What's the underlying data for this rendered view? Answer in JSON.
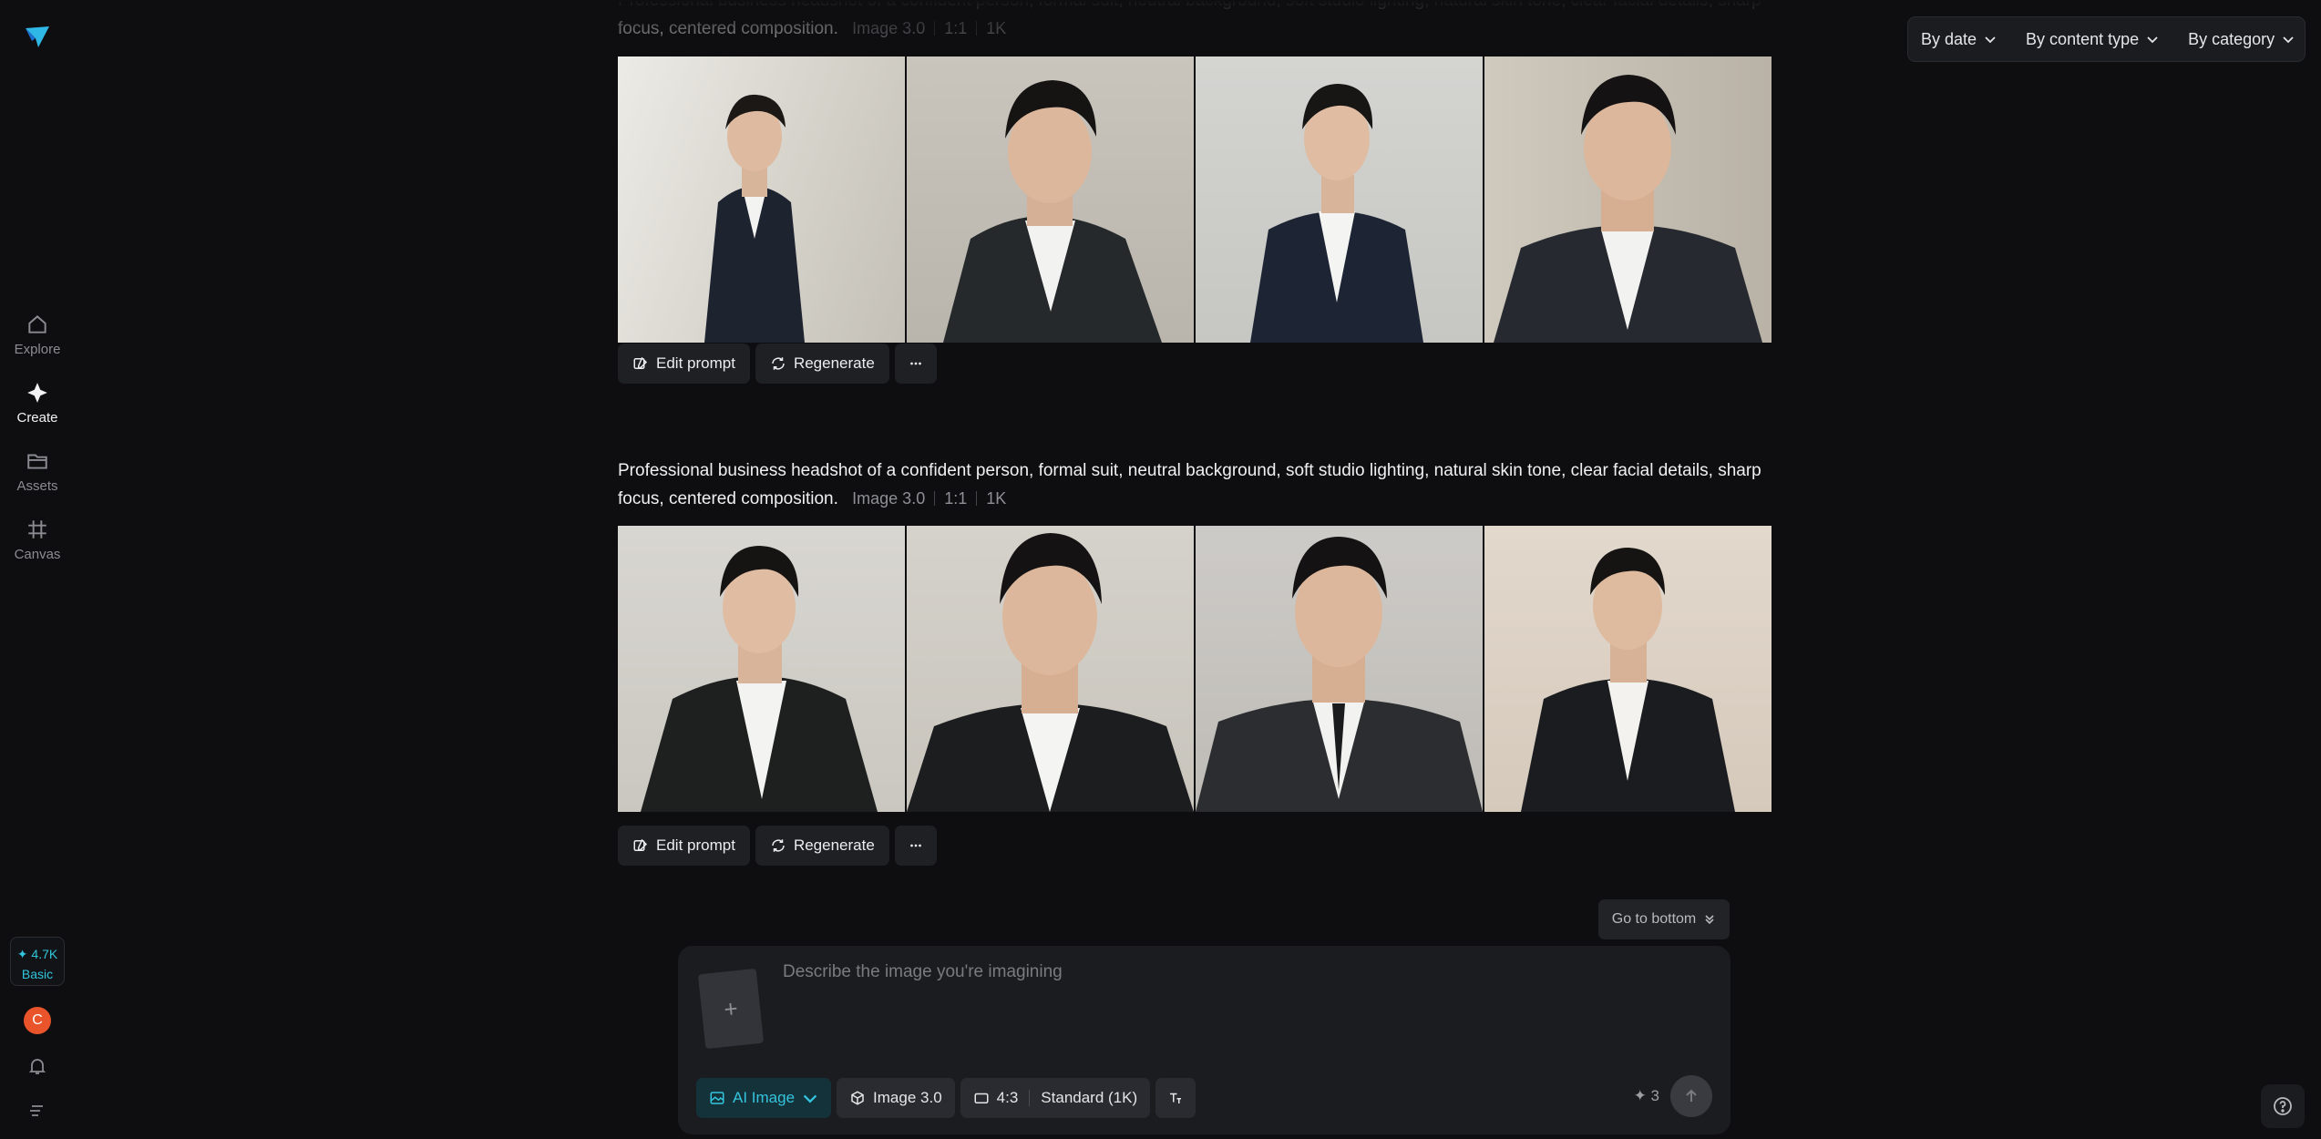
{
  "sidebar": {
    "nav": [
      {
        "label": "Explore",
        "icon": "home-icon"
      },
      {
        "label": "Create",
        "icon": "sparkle-icon"
      },
      {
        "label": "Assets",
        "icon": "folder-icon"
      },
      {
        "label": "Canvas",
        "icon": "canvas-icon"
      }
    ],
    "credits": {
      "amount": "4.7K",
      "plan": "Basic"
    },
    "avatar_letter": "C"
  },
  "filters": [
    {
      "label": "By date"
    },
    {
      "label": "By content type"
    },
    {
      "label": "By category"
    }
  ],
  "generations": [
    {
      "prompt": "Professional business headshot of a confident person, formal suit, neutral background, soft studio lighting, natural skin tone, clear facial details, sharp focus, centered composition.",
      "model": "Image 3.0",
      "ratio": "1:1",
      "resolution": "1K",
      "actions": {
        "edit": "Edit prompt",
        "regenerate": "Regenerate"
      }
    },
    {
      "prompt": "Professional business headshot of a confident person, formal suit, neutral background, soft studio lighting, natural skin tone, clear facial details, sharp focus, centered composition.",
      "model": "Image 3.0",
      "ratio": "1:1",
      "resolution": "1K",
      "actions": {
        "edit": "Edit prompt",
        "regenerate": "Regenerate"
      }
    }
  ],
  "go_to_bottom": "Go to bottom",
  "composer": {
    "placeholder": "Describe the image you're imagining",
    "mode": "AI Image",
    "model": "Image 3.0",
    "ratio": "4:3",
    "quality": "Standard (1K)",
    "cost": "3"
  },
  "colors": {
    "accent": "#34c4dd",
    "avatar": "#e9542b",
    "background": "#0e0e10"
  }
}
